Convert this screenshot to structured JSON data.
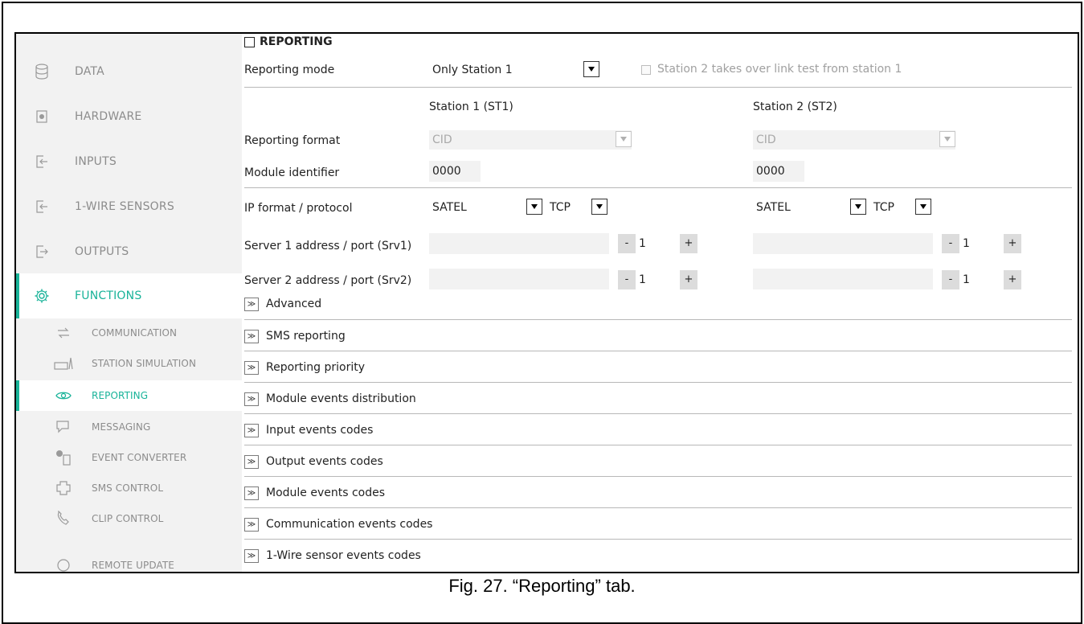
{
  "sidebar": {
    "top_items": [
      {
        "label": "DATA",
        "icon": "database-icon"
      },
      {
        "label": "HARDWARE",
        "icon": "chip-icon"
      },
      {
        "label": "INPUTS",
        "icon": "input-icon"
      },
      {
        "label": "1-WIRE SENSORS",
        "icon": "sensor-icon"
      },
      {
        "label": "OUTPUTS",
        "icon": "output-icon"
      },
      {
        "label": "FUNCTIONS",
        "icon": "gear-icon"
      }
    ],
    "sub_items": [
      {
        "label": "COMMUNICATION",
        "icon": "arrows-icon"
      },
      {
        "label": "STATION SIMULATION",
        "icon": "station-icon"
      },
      {
        "label": "REPORTING",
        "icon": "eye-icon"
      },
      {
        "label": "MESSAGING",
        "icon": "message-icon"
      },
      {
        "label": "EVENT CONVERTER",
        "icon": "converter-icon"
      },
      {
        "label": "SMS CONTROL",
        "icon": "sms-control-icon"
      },
      {
        "label": "CLIP CONTROL",
        "icon": "phone-icon"
      },
      {
        "label": "REMOTE UPDATE",
        "icon": "update-icon"
      }
    ],
    "accent_color": "#19b399"
  },
  "main": {
    "section_title": "REPORTING",
    "reporting_mode_label": "Reporting mode",
    "reporting_mode_value": "Only Station 1",
    "takeover_label": "Station 2 takes over link test from station 1",
    "station1_header": "Station 1 (ST1)",
    "station2_header": "Station 2 (ST2)",
    "format_label": "Reporting format",
    "format_st1": "CID",
    "format_st2": "CID",
    "module_id_label": "Module identifier",
    "module_id_st1": "0000",
    "module_id_st2": "0000",
    "ip_label": "IP format / protocol",
    "ip_format_st1": "SATEL",
    "ip_proto_st1": "TCP",
    "ip_format_st2": "SATEL",
    "ip_proto_st2": "TCP",
    "server1_label": "Server 1 address / port (Srv1)",
    "server2_label": "Server 2 address / port (Srv2)",
    "port_value": "1",
    "minus": "-",
    "plus": "+",
    "expanders": [
      "Advanced",
      "SMS reporting",
      "Reporting priority",
      "Module events distribution",
      "Input events codes",
      "Output events codes",
      "Module events codes",
      "Communication events codes",
      "1-Wire sensor events codes"
    ],
    "expander_glyph": "≫"
  },
  "caption": "Fig. 27. “Reporting” tab."
}
